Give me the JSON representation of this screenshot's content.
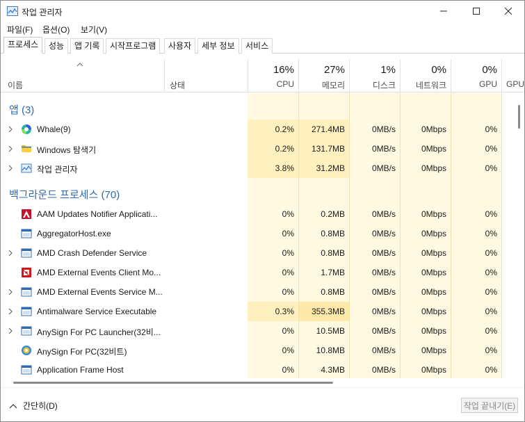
{
  "window": {
    "title": "작업 관리자"
  },
  "menu": [
    {
      "label": "파일(F)"
    },
    {
      "label": "옵션(O)"
    },
    {
      "label": "보기(V)"
    }
  ],
  "tabs": [
    {
      "label": "프로세스"
    },
    {
      "label": "성능"
    },
    {
      "label": "앱 기록"
    },
    {
      "label": "시작프로그램"
    },
    {
      "label": "사용자"
    },
    {
      "label": "세부 정보"
    },
    {
      "label": "서비스"
    }
  ],
  "header": {
    "name": "이름",
    "status": "상태",
    "cpu": {
      "pct": "16%",
      "label": "CPU"
    },
    "memory": {
      "pct": "27%",
      "label": "메모리"
    },
    "disk": {
      "pct": "1%",
      "label": "디스크"
    },
    "network": {
      "pct": "0%",
      "label": "네트워크"
    },
    "gpu": {
      "pct": "0%",
      "label": "GPU"
    },
    "gpu_engine": {
      "label": "GPU"
    }
  },
  "groups": {
    "apps": "앱 (3)",
    "background": "백그라운드 프로세스 (70)"
  },
  "apps": [
    {
      "name": "Whale(9)",
      "cpu": "0.2%",
      "mem": "271.4MB",
      "disk": "0MB/s",
      "net": "0Mbps",
      "gpu": "0%",
      "icon": "whale-icon"
    },
    {
      "name": "Windows 탐색기",
      "cpu": "0.2%",
      "mem": "131.7MB",
      "disk": "0MB/s",
      "net": "0Mbps",
      "gpu": "0%",
      "icon": "folder-icon"
    },
    {
      "name": "작업 관리자",
      "cpu": "3.8%",
      "mem": "31.2MB",
      "disk": "0MB/s",
      "net": "0Mbps",
      "gpu": "0%",
      "icon": "task-manager-icon"
    }
  ],
  "background": [
    {
      "name": "AAM Updates Notifier Applicati...",
      "cpu": "0%",
      "mem": "0.2MB",
      "disk": "0MB/s",
      "net": "0Mbps",
      "gpu": "0%",
      "icon": "adobe-icon"
    },
    {
      "name": "AggregatorHost.exe",
      "cpu": "0%",
      "mem": "0.8MB",
      "disk": "0MB/s",
      "net": "0Mbps",
      "gpu": "0%",
      "icon": "app-window-icon"
    },
    {
      "name": "AMD Crash Defender Service",
      "cpu": "0%",
      "mem": "0.8MB",
      "disk": "0MB/s",
      "net": "0Mbps",
      "gpu": "0%",
      "icon": "app-window-icon"
    },
    {
      "name": "AMD External Events Client Mo...",
      "cpu": "0%",
      "mem": "1.7MB",
      "disk": "0MB/s",
      "net": "0Mbps",
      "gpu": "0%",
      "icon": "amd-icon"
    },
    {
      "name": "AMD External Events Service M...",
      "cpu": "0%",
      "mem": "0.8MB",
      "disk": "0MB/s",
      "net": "0Mbps",
      "gpu": "0%",
      "icon": "app-window-icon"
    },
    {
      "name": "Antimalware Service Executable",
      "cpu": "0.3%",
      "mem": "355.3MB",
      "disk": "0MB/s",
      "net": "0Mbps",
      "gpu": "0%",
      "icon": "app-window-icon"
    },
    {
      "name": "AnySign For PC Launcher(32비...",
      "cpu": "0%",
      "mem": "10.5MB",
      "disk": "0MB/s",
      "net": "0Mbps",
      "gpu": "0%",
      "icon": "app-window-icon"
    },
    {
      "name": "AnySign For PC(32비트)",
      "cpu": "0%",
      "mem": "10.8MB",
      "disk": "0MB/s",
      "net": "0Mbps",
      "gpu": "0%",
      "icon": "anysign-icon"
    },
    {
      "name": "Application Frame Host",
      "cpu": "0%",
      "mem": "4.3MB",
      "disk": "0MB/s",
      "net": "0Mbps",
      "gpu": "0%",
      "icon": "app-window-icon"
    }
  ],
  "footer": {
    "fewer_details": "간단히(D)",
    "end_task": "작업 끝내기(E)"
  }
}
